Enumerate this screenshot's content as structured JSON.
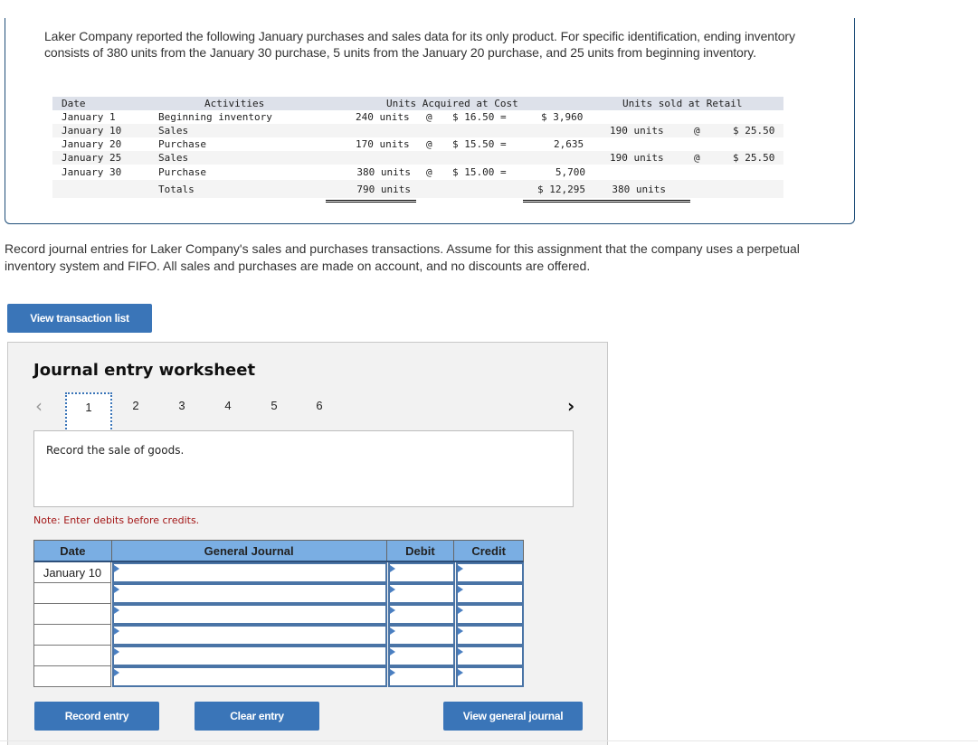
{
  "problem": {
    "intro": "Laker Company reported the following January purchases and sales data for its only product. For specific identification, ending inventory consists of 380 units from the January 30 purchase, 5 units from the January 20 purchase, and 25 units from beginning inventory.",
    "table": {
      "headers": {
        "date": "Date",
        "activities": "Activities",
        "acquired": "Units Acquired at Cost",
        "sold": "Units sold at Retail"
      },
      "rows": [
        {
          "date": "January 1",
          "activity": "Beginning inventory",
          "acq_units": "240 units",
          "acq_at": "@",
          "acq_cost": "$ 16.50 =",
          "acq_total": "$ 3,960",
          "sold_units": "",
          "sold_at": "",
          "sold_price": ""
        },
        {
          "date": "January 10",
          "activity": "Sales",
          "acq_units": "",
          "acq_at": "",
          "acq_cost": "",
          "acq_total": "",
          "sold_units": "190 units",
          "sold_at": "@",
          "sold_price": "$ 25.50"
        },
        {
          "date": "January 20",
          "activity": "Purchase",
          "acq_units": "170 units",
          "acq_at": "@",
          "acq_cost": "$ 15.50 =",
          "acq_total": "2,635",
          "sold_units": "",
          "sold_at": "",
          "sold_price": ""
        },
        {
          "date": "January 25",
          "activity": "Sales",
          "acq_units": "",
          "acq_at": "",
          "acq_cost": "",
          "acq_total": "",
          "sold_units": "190 units",
          "sold_at": "@",
          "sold_price": "$ 25.50"
        },
        {
          "date": "January 30",
          "activity": "Purchase",
          "acq_units": "380 units",
          "acq_at": "@",
          "acq_cost": "$ 15.00 =",
          "acq_total": "5,700",
          "sold_units": "",
          "sold_at": "",
          "sold_price": ""
        }
      ],
      "totals": {
        "label": "Totals",
        "acq_units": "790 units",
        "acq_total": "$ 12,295",
        "sold_units": "380 units"
      }
    }
  },
  "instruction": "Record journal entries for Laker Company's sales and purchases transactions. Assume for this assignment that the company uses a perpetual inventory system and FIFO. All sales and purchases are made on account, and no discounts are offered.",
  "buttons": {
    "view_transaction_list": "View transaction list",
    "record_entry": "Record entry",
    "clear_entry": "Clear entry",
    "view_general_journal": "View general journal"
  },
  "worksheet": {
    "title": "Journal entry worksheet",
    "prev_icon": "‹",
    "next_icon": "›",
    "tabs": [
      "1",
      "2",
      "3",
      "4",
      "5",
      "6"
    ],
    "active_tab": "1",
    "description": "Record the sale of goods.",
    "note": "Note: Enter debits before credits.",
    "journal": {
      "headers": {
        "date": "Date",
        "account": "General Journal",
        "debit": "Debit",
        "credit": "Credit"
      },
      "rows": [
        {
          "date": "January 10",
          "account": "",
          "debit": "",
          "credit": ""
        },
        {
          "date": "",
          "account": "",
          "debit": "",
          "credit": ""
        },
        {
          "date": "",
          "account": "",
          "debit": "",
          "credit": ""
        },
        {
          "date": "",
          "account": "",
          "debit": "",
          "credit": ""
        },
        {
          "date": "",
          "account": "",
          "debit": "",
          "credit": ""
        },
        {
          "date": "",
          "account": "",
          "debit": "",
          "credit": ""
        }
      ]
    }
  },
  "colors": {
    "button_blue": "#3a75b8",
    "header_blue": "#7aaee3",
    "note_red": "#a31515",
    "panel_border": "#1f4e79"
  }
}
